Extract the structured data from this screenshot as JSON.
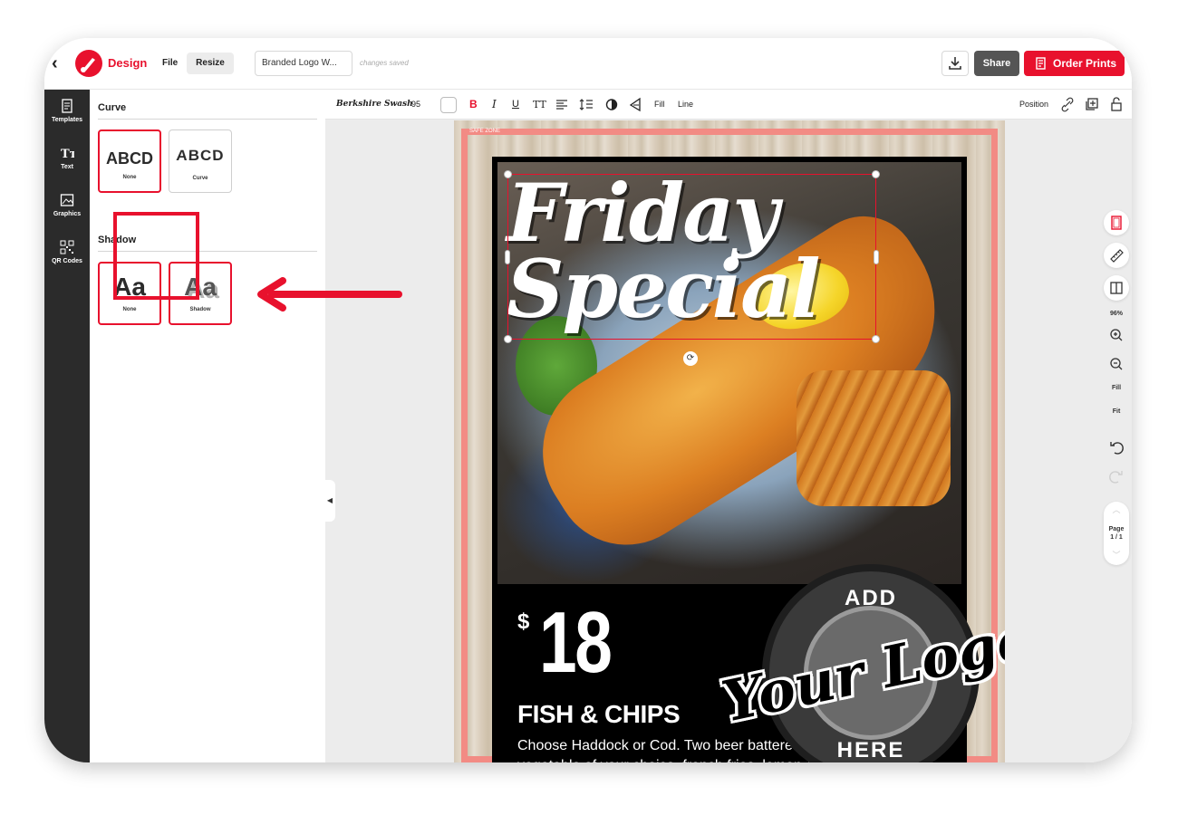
{
  "header": {
    "app_label": "Design",
    "file_menu": "File",
    "resize_label": "Resize",
    "document_title": "Branded Logo W...",
    "save_status": "changes saved",
    "share_label": "Share",
    "order_label": "Order Prints"
  },
  "rail": {
    "items": [
      {
        "label": "Templates",
        "icon": "templates-icon"
      },
      {
        "label": "Text",
        "icon": "text-icon"
      },
      {
        "label": "Graphics",
        "icon": "graphics-icon"
      },
      {
        "label": "QR Codes",
        "icon": "qr-code-icon"
      }
    ]
  },
  "panel": {
    "curve": {
      "title": "Curve",
      "options": [
        {
          "preview": "ABCD",
          "label": "None",
          "selected": true
        },
        {
          "preview": "ABCD",
          "label": "Curve",
          "selected": false
        }
      ]
    },
    "shadow": {
      "title": "Shadow",
      "options": [
        {
          "preview": "Aa",
          "label": "None",
          "selected": true
        },
        {
          "preview": "Aa",
          "label": "Shadow",
          "selected": true
        }
      ]
    }
  },
  "format_bar": {
    "font_name": "Berkshire Swash",
    "font_size": "95",
    "bold": "B",
    "italic": "I",
    "underline": "U",
    "text_case": "TT",
    "fill": "Fill",
    "line": "Line",
    "position": "Position"
  },
  "tools": {
    "zoom": "96%",
    "fill": "Fill",
    "fit": "Fit",
    "page_label": "Page",
    "page_count": "1 / 1"
  },
  "canvas": {
    "safe_zone_label": "SAFE ZONE",
    "headline_line1": "Friday",
    "headline_line2": "Special",
    "price_symbol": "$",
    "price": "18",
    "item_name": "FISH & CHIPS",
    "item_description": "Choose Haddock or Cod. Two beer battered filets served with vegetable of your choice, french fries, lemon and tartar sauce",
    "logo_top": "ADD",
    "logo_script": "Your Logo",
    "logo_bottom": "HERE"
  },
  "colors": {
    "brand_red": "#e8112d",
    "safe_zone": "#f28b84",
    "rail_bg": "#2b2b2b",
    "workspace_bg": "#ececec"
  }
}
